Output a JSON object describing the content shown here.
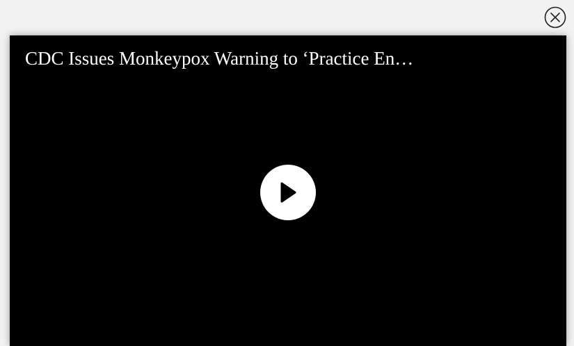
{
  "video": {
    "title": "CDC Issues Monkeypox Warning to ‘Practice En…"
  },
  "controls": {
    "close_icon": "close-circle-icon",
    "play_icon": "play-icon"
  },
  "colors": {
    "page_background": "#f2f2f2",
    "player_background": "#000000",
    "title_text": "#ffffff",
    "play_button": "#ffffff",
    "close_icon": "#222222"
  }
}
